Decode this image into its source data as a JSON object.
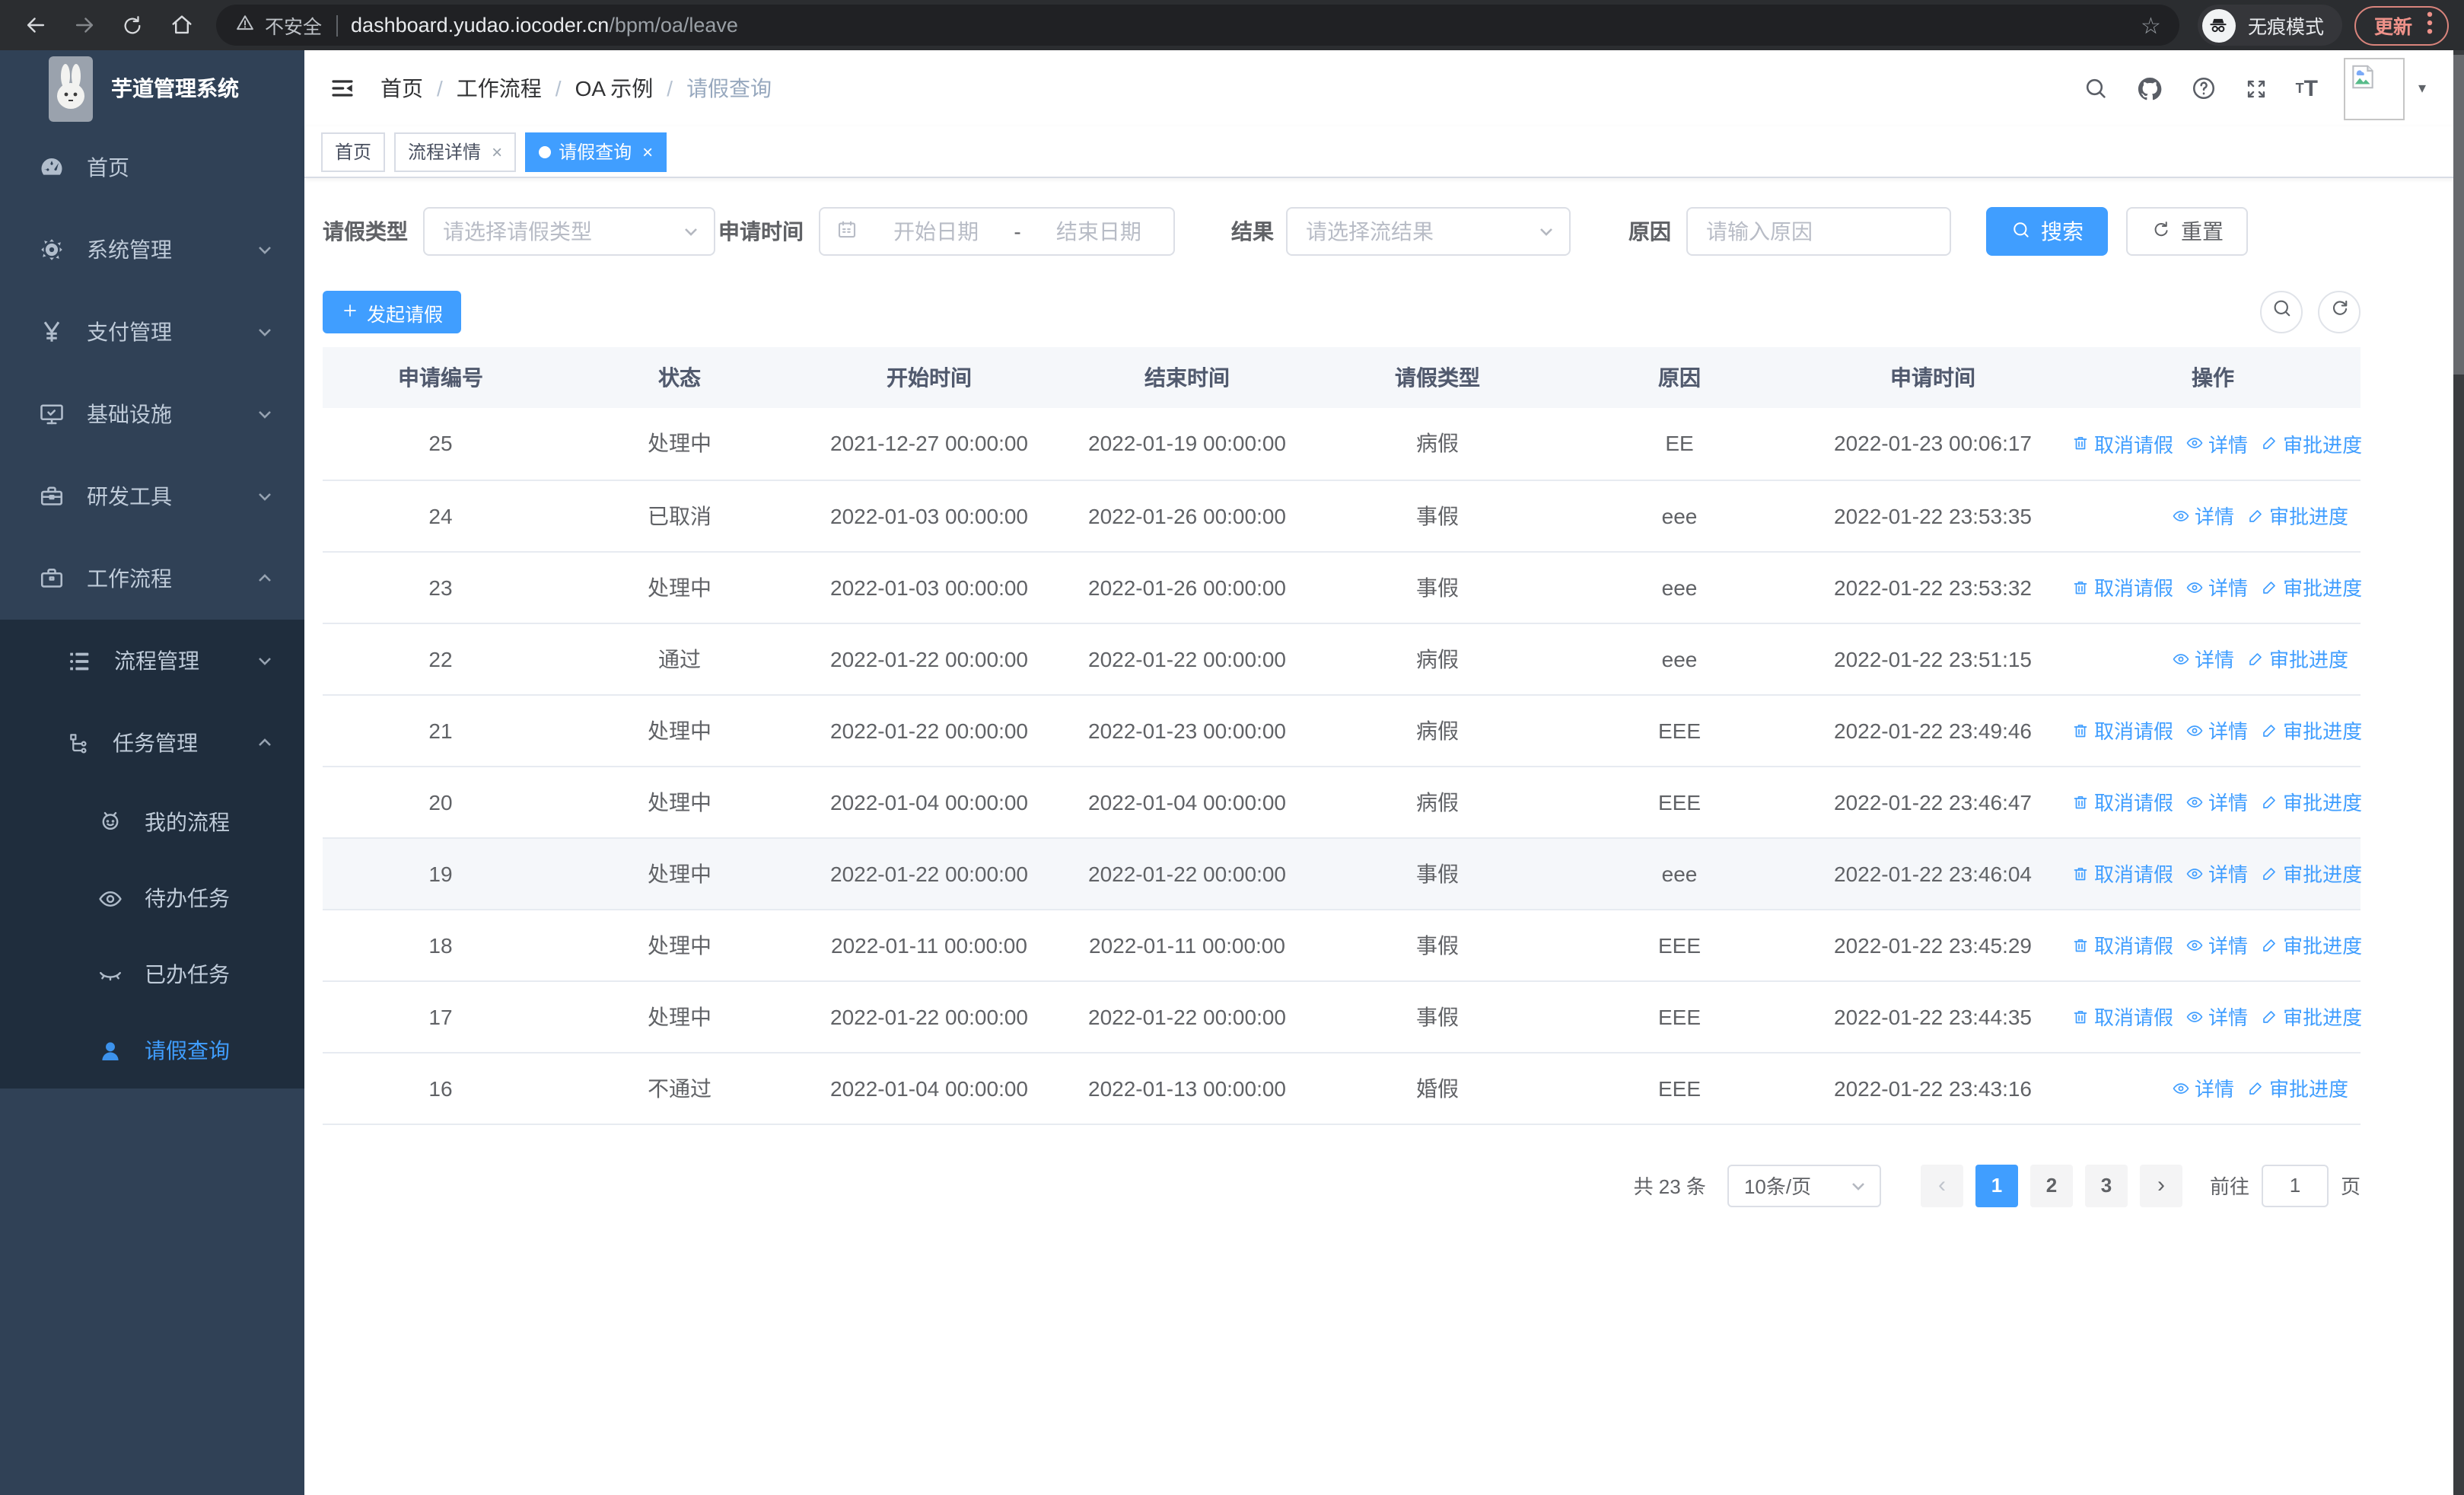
{
  "colors": {
    "accent": "#409eff",
    "sidebar_bg": "#304156",
    "submenu_bg": "#1f2d3d",
    "update_accent": "#ee9189"
  },
  "browser": {
    "security_label": "不安全",
    "url_host": "dashboard.yudao.iocoder.cn",
    "url_path": "/bpm/oa/leave",
    "incognito_label": "无痕模式",
    "update_label": "更新"
  },
  "sidebar": {
    "app_title": "芋道管理系统",
    "items": [
      {
        "label": "首页",
        "icon": "dashboard-icon",
        "level": 0
      },
      {
        "label": "系统管理",
        "icon": "gear-icon",
        "level": 0,
        "chevron": "down"
      },
      {
        "label": "支付管理",
        "icon": "yen-icon",
        "level": 0,
        "chevron": "down"
      },
      {
        "label": "基础设施",
        "icon": "monitor-icon",
        "level": 0,
        "chevron": "down"
      },
      {
        "label": "研发工具",
        "icon": "toolbox-icon",
        "level": 0,
        "chevron": "down"
      },
      {
        "label": "工作流程",
        "icon": "briefcase-icon",
        "level": 0,
        "chevron": "up"
      },
      {
        "label": "流程管理",
        "icon": "flow-list-icon",
        "level": 1,
        "chevron": "down"
      },
      {
        "label": "任务管理",
        "icon": "org-tree-icon",
        "level": 1,
        "chevron": "up"
      },
      {
        "label": "我的流程",
        "icon": "people-icon",
        "level": 2
      },
      {
        "label": "待办任务",
        "icon": "eye-open-icon",
        "level": 2
      },
      {
        "label": "已办任务",
        "icon": "eye-closed-icon",
        "level": 2
      },
      {
        "label": "请假查询",
        "icon": "user-icon",
        "level": 2,
        "active": true
      }
    ]
  },
  "breadcrumb": {
    "separator": "/",
    "items": [
      "首页",
      "工作流程",
      "OA 示例",
      "请假查询"
    ]
  },
  "tabs": [
    {
      "label": "首页",
      "closable": false,
      "active": false
    },
    {
      "label": "流程详情",
      "closable": true,
      "active": false
    },
    {
      "label": "请假查询",
      "closable": true,
      "active": true
    }
  ],
  "filters": {
    "leave_type_label": "请假类型",
    "leave_type_placeholder": "请选择请假类型",
    "apply_time_label": "申请时间",
    "start_date_placeholder": "开始日期",
    "date_separator": "-",
    "end_date_placeholder": "结束日期",
    "result_label": "结果",
    "result_placeholder": "请选择流结果",
    "reason_label": "原因",
    "reason_placeholder": "请输入原因",
    "search_label": "搜索",
    "reset_label": "重置"
  },
  "toolbar": {
    "create_label": "发起请假"
  },
  "table": {
    "columns": [
      "申请编号",
      "状态",
      "开始时间",
      "结束时间",
      "请假类型",
      "原因",
      "申请时间",
      "操作"
    ],
    "action_defs": {
      "cancel": {
        "label": "取消请假",
        "icon": "trash-icon"
      },
      "detail": {
        "label": "详情",
        "icon": "view-eye-icon"
      },
      "progress": {
        "label": "审批进度",
        "icon": "edit-pen-icon"
      }
    },
    "rows": [
      {
        "id": "25",
        "status": "处理中",
        "start": "2021-12-27 00:00:00",
        "end": "2022-01-19 00:00:00",
        "type": "病假",
        "reason": "EE",
        "apply_time": "2022-01-23 00:06:17",
        "actions": [
          "cancel",
          "detail",
          "progress"
        ]
      },
      {
        "id": "24",
        "status": "已取消",
        "start": "2022-01-03 00:00:00",
        "end": "2022-01-26 00:00:00",
        "type": "事假",
        "reason": "eee",
        "apply_time": "2022-01-22 23:53:35",
        "actions": [
          "detail",
          "progress"
        ]
      },
      {
        "id": "23",
        "status": "处理中",
        "start": "2022-01-03 00:00:00",
        "end": "2022-01-26 00:00:00",
        "type": "事假",
        "reason": "eee",
        "apply_time": "2022-01-22 23:53:32",
        "actions": [
          "cancel",
          "detail",
          "progress"
        ]
      },
      {
        "id": "22",
        "status": "通过",
        "start": "2022-01-22 00:00:00",
        "end": "2022-01-22 00:00:00",
        "type": "病假",
        "reason": "eee",
        "apply_time": "2022-01-22 23:51:15",
        "actions": [
          "detail",
          "progress"
        ]
      },
      {
        "id": "21",
        "status": "处理中",
        "start": "2022-01-22 00:00:00",
        "end": "2022-01-23 00:00:00",
        "type": "病假",
        "reason": "EEE",
        "apply_time": "2022-01-22 23:49:46",
        "actions": [
          "cancel",
          "detail",
          "progress"
        ]
      },
      {
        "id": "20",
        "status": "处理中",
        "start": "2022-01-04 00:00:00",
        "end": "2022-01-04 00:00:00",
        "type": "病假",
        "reason": "EEE",
        "apply_time": "2022-01-22 23:46:47",
        "actions": [
          "cancel",
          "detail",
          "progress"
        ]
      },
      {
        "id": "19",
        "status": "处理中",
        "start": "2022-01-22 00:00:00",
        "end": "2022-01-22 00:00:00",
        "type": "事假",
        "reason": "eee",
        "apply_time": "2022-01-22 23:46:04",
        "actions": [
          "cancel",
          "detail",
          "progress"
        ],
        "hover": true
      },
      {
        "id": "18",
        "status": "处理中",
        "start": "2022-01-11 00:00:00",
        "end": "2022-01-11 00:00:00",
        "type": "事假",
        "reason": "EEE",
        "apply_time": "2022-01-22 23:45:29",
        "actions": [
          "cancel",
          "detail",
          "progress"
        ]
      },
      {
        "id": "17",
        "status": "处理中",
        "start": "2022-01-22 00:00:00",
        "end": "2022-01-22 00:00:00",
        "type": "事假",
        "reason": "EEE",
        "apply_time": "2022-01-22 23:44:35",
        "actions": [
          "cancel",
          "detail",
          "progress"
        ]
      },
      {
        "id": "16",
        "status": "不通过",
        "start": "2022-01-04 00:00:00",
        "end": "2022-01-13 00:00:00",
        "type": "婚假",
        "reason": "EEE",
        "apply_time": "2022-01-22 23:43:16",
        "actions": [
          "detail",
          "progress"
        ]
      }
    ]
  },
  "pagination": {
    "total": "共 23 条",
    "page_size": "10条/页",
    "prev": "‹",
    "next": "›",
    "pages": [
      "1",
      "2",
      "3"
    ],
    "active_page": "1",
    "goto_label": "前往",
    "goto_value": "1",
    "unit_label": "页"
  }
}
